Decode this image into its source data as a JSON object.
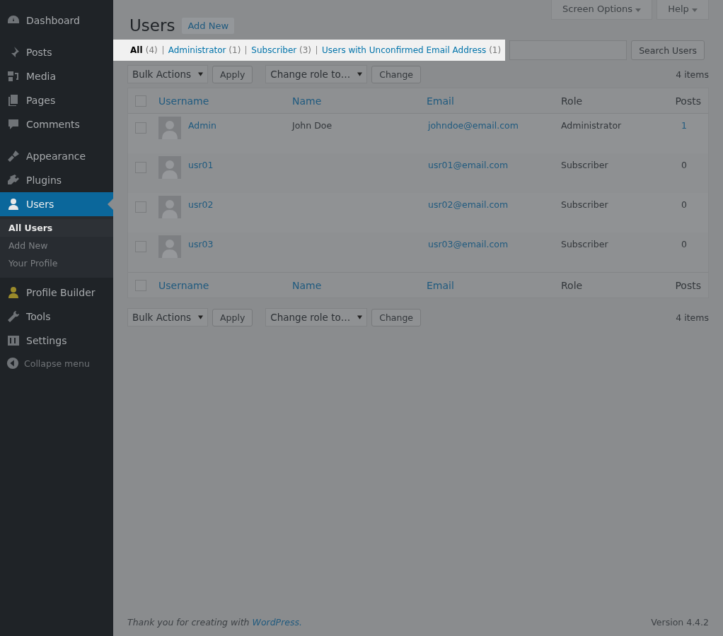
{
  "sidebar": {
    "items": [
      {
        "label": "Dashboard",
        "selected": false,
        "kind": "item"
      },
      {
        "label": "Posts",
        "selected": false,
        "kind": "item"
      },
      {
        "label": "Media",
        "selected": false,
        "kind": "item"
      },
      {
        "label": "Pages",
        "selected": false,
        "kind": "item"
      },
      {
        "label": "Comments",
        "selected": false,
        "kind": "item"
      },
      {
        "label": "Appearance",
        "selected": false,
        "kind": "item"
      },
      {
        "label": "Plugins",
        "selected": false,
        "kind": "item"
      },
      {
        "label": "Users",
        "selected": true,
        "kind": "item",
        "children": [
          {
            "label": "All Users",
            "selected": true
          },
          {
            "label": "Add New",
            "selected": false
          },
          {
            "label": "Your Profile",
            "selected": false
          }
        ]
      },
      {
        "label": "Profile Builder",
        "selected": false,
        "kind": "item"
      },
      {
        "label": "Tools",
        "selected": false,
        "kind": "item"
      },
      {
        "label": "Settings",
        "selected": false,
        "kind": "item"
      },
      {
        "label": "Collapse menu",
        "selected": false,
        "kind": "collapse"
      }
    ]
  },
  "header_buttons": [
    "Screen Options",
    "Help"
  ],
  "page": {
    "title": "Users",
    "add_new": "Add New"
  },
  "filters": [
    {
      "label": "All",
      "count": "(4)",
      "selected": true
    },
    {
      "label": "Administrator",
      "count": "(1)",
      "selected": false
    },
    {
      "label": "Subscriber",
      "count": "(3)",
      "selected": false
    },
    {
      "label": "Users with Unconfirmed Email Address",
      "count": "(1)",
      "selected": false
    }
  ],
  "search": {
    "button": "Search Users"
  },
  "top_actions": {
    "bulk": "Bulk Actions",
    "apply": "Apply",
    "role": "Change role to…",
    "change": "Change",
    "count": "4 items"
  },
  "table": {
    "header_checked": false,
    "footer_checked": false,
    "columns": [
      "Username",
      "Name",
      "Email",
      "Role",
      "Posts"
    ],
    "rows": [
      {
        "checked": false,
        "username": "Admin",
        "name": "John Doe",
        "email": "johndoe@email.com",
        "role": "Administrator",
        "posts": "1"
      },
      {
        "checked": false,
        "username": "usr01",
        "email": "usr01@email.com",
        "role": "Subscriber",
        "posts": "0"
      },
      {
        "checked": false,
        "username": "usr02",
        "email": "usr02@email.com",
        "role": "Subscriber",
        "posts": "0"
      },
      {
        "checked": false,
        "username": "usr03",
        "email": "usr03@email.com",
        "role": "Subscriber",
        "posts": "0"
      }
    ],
    "footer_columns": [
      "Username",
      "Name",
      "Email",
      "Role",
      "Posts"
    ]
  },
  "bottom_actions": {
    "bulk": "Bulk Actions",
    "apply": "Apply",
    "role": "Change role to…",
    "change": "Change",
    "count": "4 items"
  },
  "footer": {
    "text": "Thank you for creating with",
    "link": "WordPress.",
    "version": "Version 4.4.2"
  }
}
